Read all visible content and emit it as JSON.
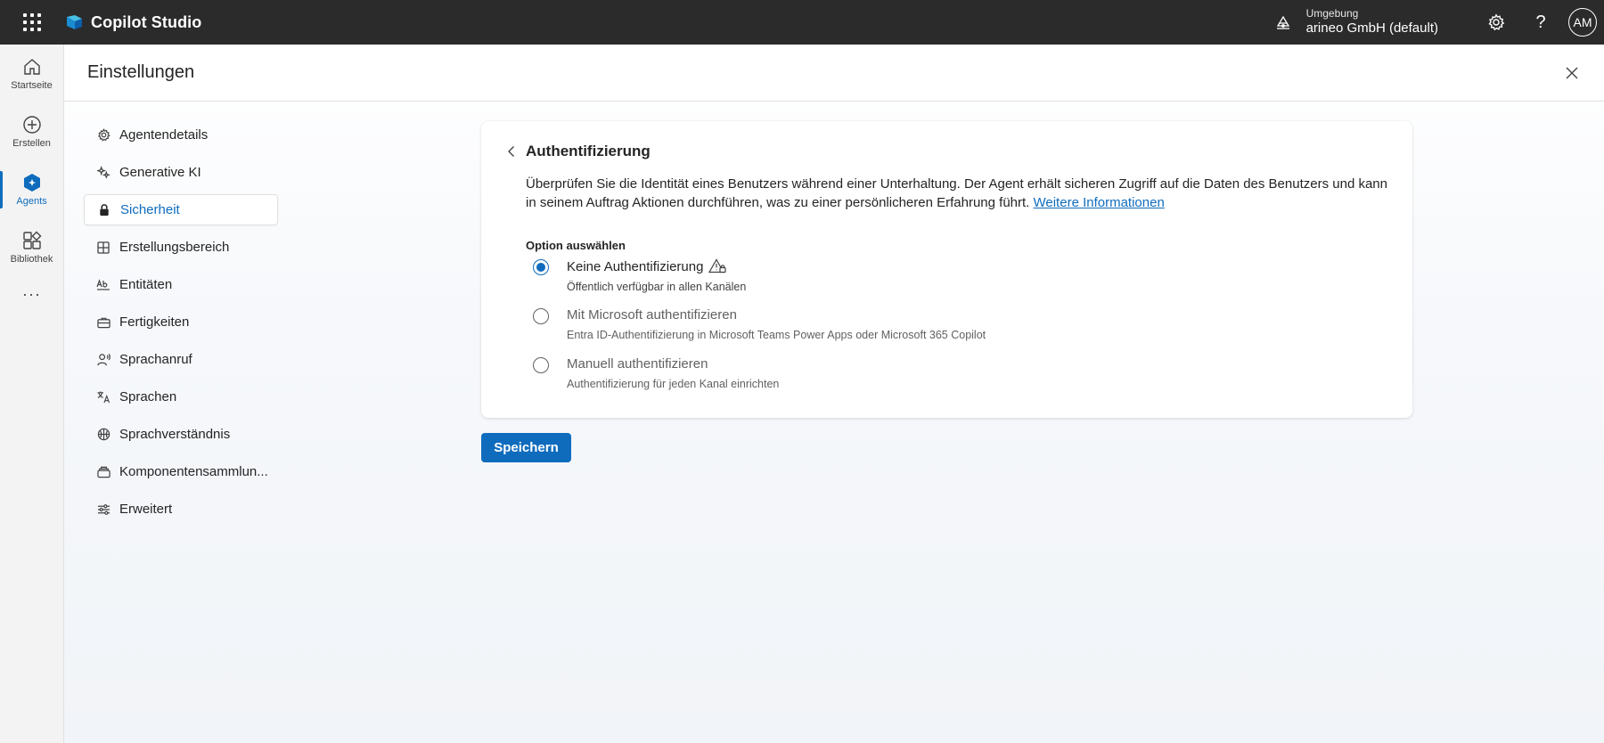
{
  "app": {
    "title": "Copilot Studio"
  },
  "environment": {
    "label": "Umgebung",
    "value": "arineo GmbH (default)"
  },
  "user": {
    "initials": "AM"
  },
  "topbar": {
    "help_glyph": "?"
  },
  "rail": {
    "items": [
      {
        "label": "Startseite",
        "icon": "home-icon"
      },
      {
        "label": "Erstellen",
        "icon": "add-circle-icon"
      },
      {
        "label": "Agents",
        "icon": "agents-icon",
        "active": true
      },
      {
        "label": "Bibliothek",
        "icon": "library-icon"
      }
    ],
    "more": "···"
  },
  "page": {
    "title": "Einstellungen"
  },
  "nav": {
    "items": [
      {
        "label": "Agentendetails",
        "icon": "gear-icon"
      },
      {
        "label": "Generative KI",
        "icon": "sparkle-icon"
      },
      {
        "label": "Sicherheit",
        "icon": "lock-icon",
        "active": true
      },
      {
        "label": "Erstellungsbereich",
        "icon": "grid-icon"
      },
      {
        "label": "Entitäten",
        "icon": "text-ab-icon"
      },
      {
        "label": "Fertigkeiten",
        "icon": "briefcase-icon"
      },
      {
        "label": "Sprachanruf",
        "icon": "person-voice-icon"
      },
      {
        "label": "Sprachen",
        "icon": "translate-icon"
      },
      {
        "label": "Sprachverständnis",
        "icon": "brain-icon"
      },
      {
        "label": "Komponentensammlun...",
        "icon": "box-icon"
      },
      {
        "label": "Erweitert",
        "icon": "sliders-icon"
      }
    ]
  },
  "card": {
    "title": "Authentifizierung",
    "description": "Überprüfen Sie die Identität eines Benutzers während einer Unterhaltung. Der Agent erhält sicheren Zugriff auf die Daten des Benutzers und kann in seinem Auftrag Aktionen durchführen, was zu einer persönlicheren Erfahrung führt.",
    "link": "Weitere Informationen",
    "option_heading": "Option auswählen",
    "options": [
      {
        "label": "Keine Authentifizierung",
        "sub": "Öffentlich verfügbar in allen Kanälen",
        "checked": true
      },
      {
        "label": "Mit Microsoft authentifizieren",
        "sub": "Entra ID-Authentifizierung in Microsoft Teams Power Apps oder Microsoft 365 Copilot",
        "checked": false
      },
      {
        "label": "Manuell authentifizieren",
        "sub": "Authentifizierung für jeden Kanal einrichten",
        "checked": false
      }
    ]
  },
  "actions": {
    "save": "Speichern"
  },
  "colors": {
    "accent": "#0f6cbd",
    "topbar": "#2b2b2b"
  }
}
